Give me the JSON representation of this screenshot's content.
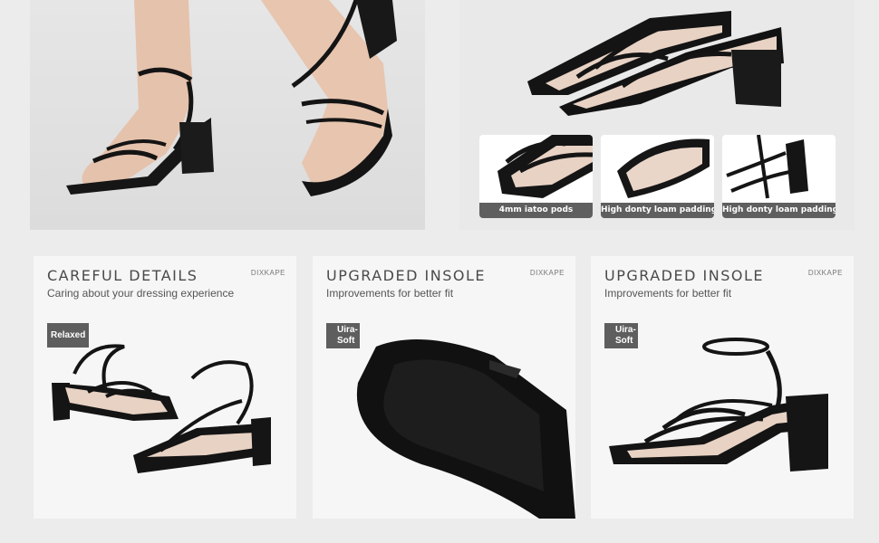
{
  "top_thumbs": [
    "4mm iatoo pods",
    "High donty loam padding",
    "High donty loam padding"
  ],
  "panels": [
    {
      "title": "CAREFUL DETAILS",
      "subtitle": "Caring about your dressing experience",
      "brand": "DIXKAPE",
      "badge": "Relaxed"
    },
    {
      "title": "UPGRADED INSOLE",
      "subtitle": "Improvements for better fit",
      "brand": "DIXKAPE",
      "badge_line1": "Uira-",
      "badge_line2": "Soft"
    },
    {
      "title": "UPGRADED INSOLE",
      "subtitle": "Improvements for better fit",
      "brand": "DIXKAPE",
      "badge_line1": "Uira-",
      "badge_line2": "Soft"
    }
  ],
  "colors": {
    "background": "#ececec",
    "caption_bar": "#5f5f5f",
    "shoe": "#151515",
    "insole": "#e8d2c4"
  }
}
